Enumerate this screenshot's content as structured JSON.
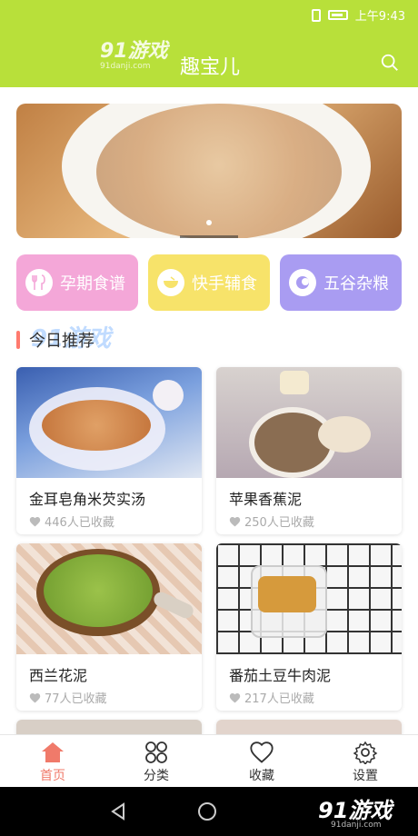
{
  "status_bar": {
    "time": "上午9:43"
  },
  "app_bar": {
    "title": "趣宝儿",
    "watermark": "91游戏",
    "watermark_url": "91danji.com"
  },
  "banner": {
    "image": "porridge bowl"
  },
  "categories": [
    {
      "label": "孕期食谱",
      "color": "#f4a7d8",
      "icon": "fork-spoon-icon"
    },
    {
      "label": "快手辅食",
      "color": "#f7e36a",
      "icon": "bowl-icon"
    },
    {
      "label": "五谷杂粮",
      "color": "#a99cf2",
      "icon": "grain-icon"
    }
  ],
  "section": {
    "title": "今日推荐"
  },
  "recipes": [
    {
      "name": "金耳皂角米芡实汤",
      "favorites": "446人已收藏"
    },
    {
      "name": "苹果香蕉泥",
      "favorites": "250人已收藏"
    },
    {
      "name": "西兰花泥",
      "favorites": "77人已收藏"
    },
    {
      "name": "番茄土豆牛肉泥",
      "favorites": "217人已收藏"
    }
  ],
  "tabs": [
    {
      "label": "首页",
      "icon": "home-icon",
      "active": true
    },
    {
      "label": "分类",
      "icon": "grid-icon",
      "active": false
    },
    {
      "label": "收藏",
      "icon": "heart-icon",
      "active": false
    },
    {
      "label": "设置",
      "icon": "gear-icon",
      "active": false
    }
  ],
  "nav_watermark": {
    "text": "91游戏",
    "url": "91danji.com"
  }
}
